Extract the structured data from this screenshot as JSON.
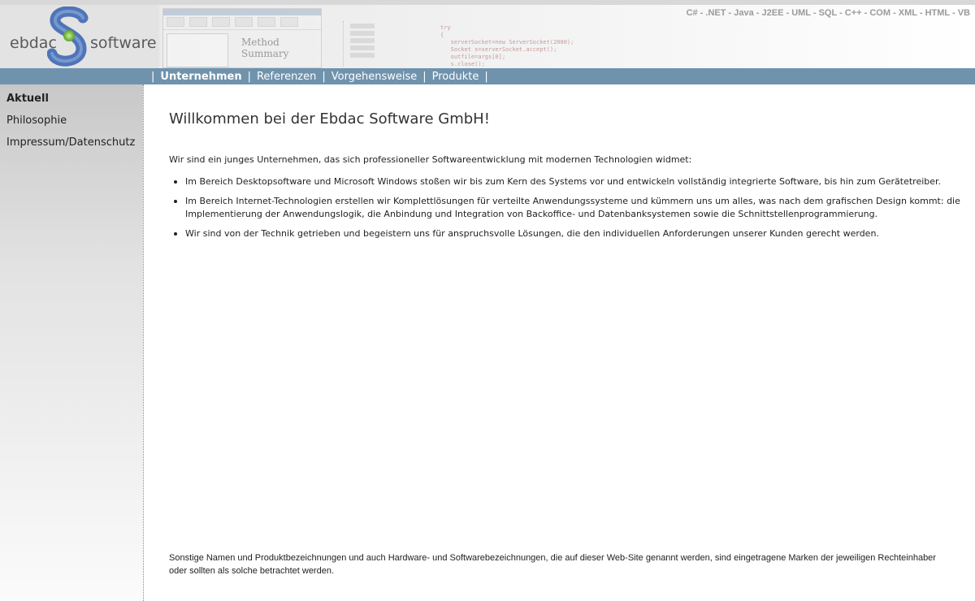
{
  "header": {
    "logo_left": "ebdac",
    "logo_right": "software",
    "tech_list": "C# - .NET - Java - J2EE - UML - SQL - C++ - COM - XML - HTML - VB"
  },
  "nav": {
    "separator": "|",
    "items": [
      {
        "label": "Unternehmen",
        "active": true
      },
      {
        "label": "Referenzen",
        "active": false
      },
      {
        "label": "Vorgehensweise",
        "active": false
      },
      {
        "label": "Produkte",
        "active": false
      }
    ]
  },
  "sidebar": {
    "items": [
      {
        "label": "Aktuell",
        "active": true
      },
      {
        "label": "Philosophie",
        "active": false
      },
      {
        "label": "Impressum/Datenschutz",
        "active": false
      }
    ]
  },
  "main": {
    "title": "Willkommen bei der Ebdac Software GmbH!",
    "intro": "Wir sind ein junges Unternehmen, das sich professioneller Softwareentwicklung mit modernen Technologien widmet:",
    "bullets": [
      "Im Bereich Desktopsoftware und Microsoft Windows stoßen wir bis zum Kern des Systems vor und entwickeln vollständig integrierte Software, bis hin zum Gerätetreiber.",
      "Im Bereich Internet-Technologien erstellen wir Komplettlösungen für verteilte Anwendungssysteme und kümmern uns um alles, was nach dem grafischen Design kommt: die Implementierung der Anwendungslogik, die Anbindung und Integration von Backoffice- und Datenbanksystemen sowie die Schnittstellenprogrammierung.",
      "Wir sind von der Technik getrieben und begeistern uns für anspruchsvolle Lösungen, die den individuellen Anforderungen unserer Kunden gerecht werden."
    ],
    "footer_note": "Sonstige Namen und Produktbezeichnungen und auch Hardware- und Softwarebezeichnungen, die auf dieser Web-Site genannt werden, sind eingetragene Marken der jeweiligen Rechteinhaber oder sollten als solche betrachtet werden."
  },
  "collage": {
    "window_label": "Method Summary",
    "code": "try\n{\n   serverSocket=new ServerSocket(2000);\n   Socket s=serverSocket.accept();\n   outfile=args[0];\n   s.close();\n   System.out.println(outfile);"
  },
  "colors": {
    "nav_bg": "#6f93ad",
    "logo_blue": "#4f74b8",
    "logo_green": "#7fc04a"
  }
}
